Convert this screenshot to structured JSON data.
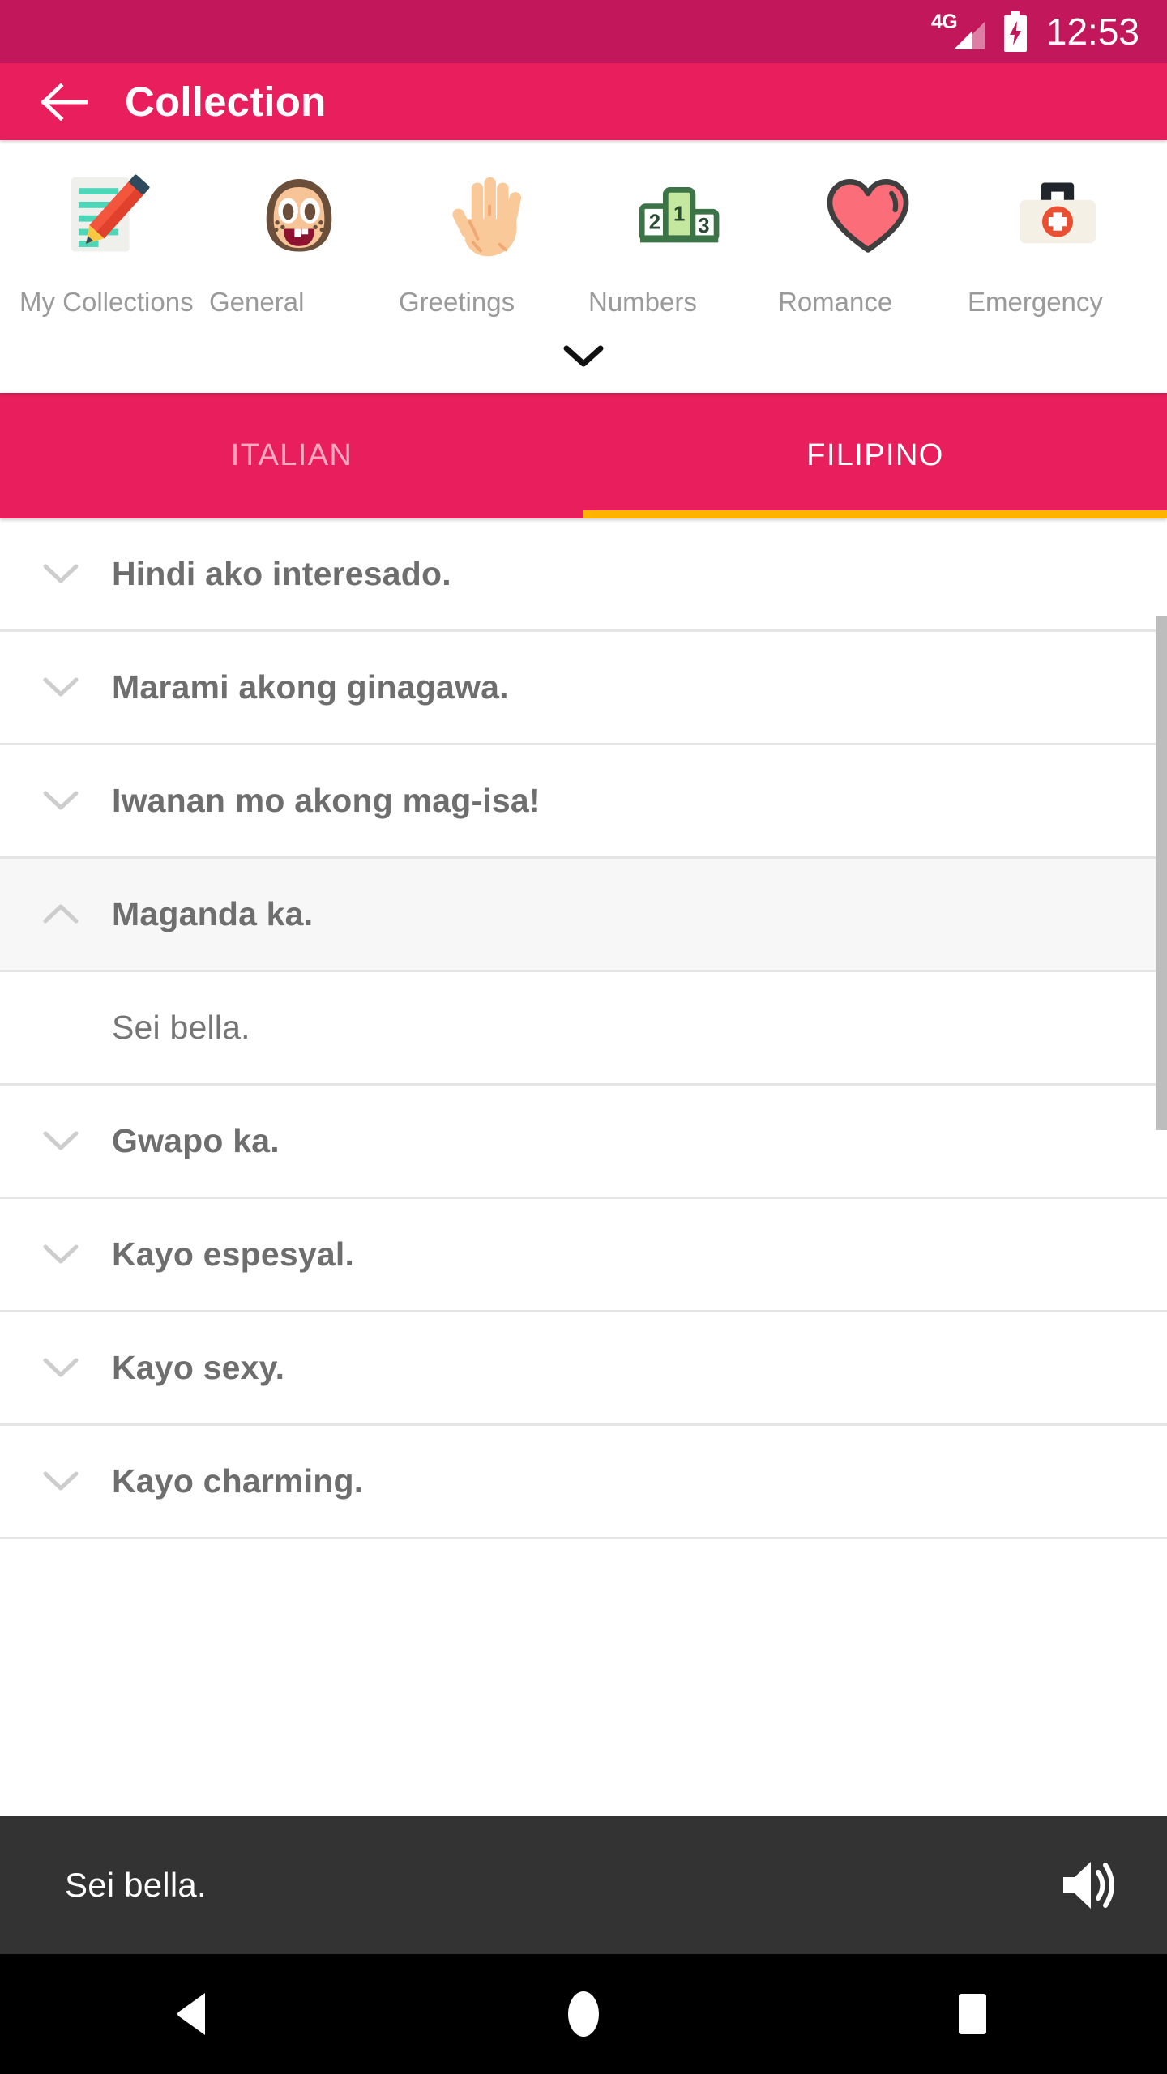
{
  "status_bar": {
    "network_label": "4G",
    "time": "12:53",
    "signal_icon": "signal-bars-icon",
    "battery_icon": "battery-charging-icon",
    "background_color": "#C2175B"
  },
  "app_bar": {
    "back_icon": "arrow-left-icon",
    "title": "Collection",
    "background_color": "#E91E5C"
  },
  "categories": {
    "expand_icon": "chevron-down-icon",
    "items": [
      {
        "label": "My Collections",
        "icon": "notepad-pencil-icon"
      },
      {
        "label": "General",
        "icon": "girl-face-icon"
      },
      {
        "label": "Greetings",
        "icon": "open-hand-icon"
      },
      {
        "label": "Numbers",
        "icon": "podium-icon"
      },
      {
        "label": "Romance",
        "icon": "heart-icon"
      },
      {
        "label": "Emergency",
        "icon": "first-aid-kit-icon"
      }
    ]
  },
  "language_tabs": {
    "indicator_color": "#FFB300",
    "items": [
      {
        "label": "ITALIAN",
        "active": false
      },
      {
        "label": "FILIPINO",
        "active": true
      }
    ]
  },
  "phrase_list": {
    "rows": [
      {
        "phrase": "Hindi ako interesado.",
        "expanded": false,
        "chevron": "chevron-down-icon"
      },
      {
        "phrase": "Marami akong ginagawa.",
        "expanded": false,
        "chevron": "chevron-down-icon"
      },
      {
        "phrase": "Iwanan mo akong mag-isa!",
        "expanded": false,
        "chevron": "chevron-down-icon"
      },
      {
        "phrase": "Maganda ka.",
        "expanded": true,
        "chevron": "chevron-up-icon",
        "translation": "Sei bella."
      },
      {
        "phrase": "Gwapo ka.",
        "expanded": false,
        "chevron": "chevron-down-icon"
      },
      {
        "phrase": "Kayo espesyal.",
        "expanded": false,
        "chevron": "chevron-down-icon"
      },
      {
        "phrase": "Kayo sexy.",
        "expanded": false,
        "chevron": "chevron-down-icon"
      },
      {
        "phrase": "Kayo charming.",
        "expanded": false,
        "chevron": "chevron-down-icon"
      }
    ]
  },
  "player_bar": {
    "text": "Sei bella.",
    "speaker_icon": "volume-up-icon",
    "background_color": "#333333"
  },
  "nav_bar": {
    "back_icon": "nav-back-triangle-icon",
    "home_icon": "nav-home-circle-icon",
    "recents_icon": "nav-recents-square-icon"
  }
}
